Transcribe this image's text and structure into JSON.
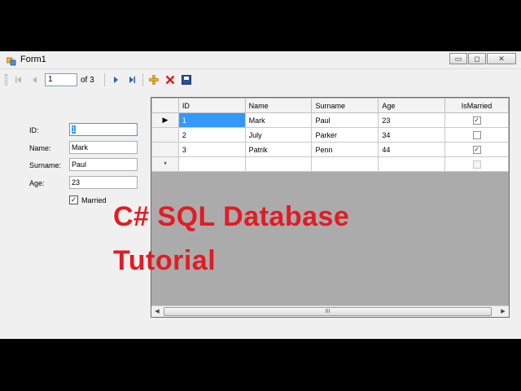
{
  "window": {
    "title": "Form1",
    "controls": {
      "minimize": "▭",
      "maximize": "◻",
      "close": "✕"
    }
  },
  "navigator": {
    "position": "1",
    "count_label": "of 3"
  },
  "form": {
    "id_label": "ID:",
    "id_value": "1",
    "name_label": "Name:",
    "name_value": "Mark",
    "surname_label": "Surname:",
    "surname_value": "Paul",
    "age_label": "Age:",
    "age_value": "23",
    "married_label": "Married",
    "married_checked": true
  },
  "grid": {
    "columns": [
      "ID",
      "Name",
      "Surname",
      "Age",
      "IsMarried"
    ],
    "rows": [
      {
        "id": "1",
        "name": "Mark",
        "surname": "Paul",
        "age": "23",
        "married": true
      },
      {
        "id": "2",
        "name": "July",
        "surname": "Parker",
        "age": "34",
        "married": false
      },
      {
        "id": "3",
        "name": "Patrik",
        "surname": "Penn",
        "age": "44",
        "married": true
      }
    ],
    "new_row_marker": "*",
    "current_row_marker": "▶",
    "scroll_thumb_grip": "III"
  },
  "overlay": {
    "line1": "C# SQL Database",
    "line2": "Tutorial"
  },
  "colors": {
    "overlay_text": "#e31b23",
    "selection": "#3399ff",
    "grid_background": "#ababab"
  }
}
